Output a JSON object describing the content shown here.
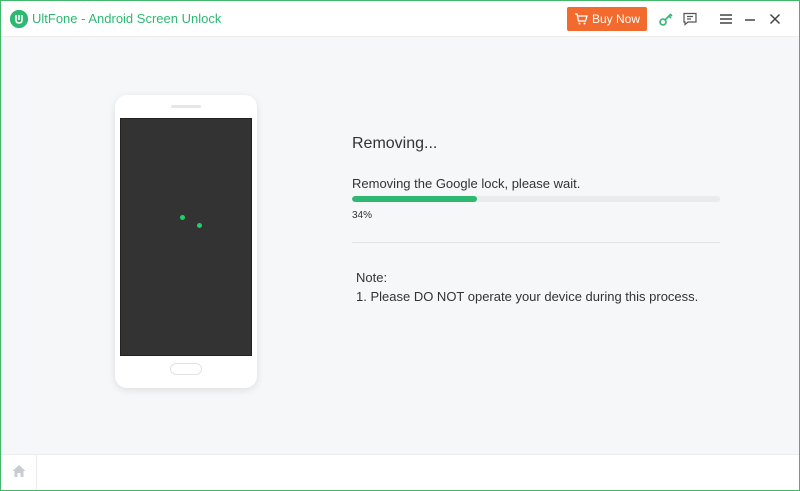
{
  "window": {
    "title": "UltFone - Android Screen Unlock",
    "accent_color": "#2eb872",
    "logo_icon": "ultfone-logo-icon"
  },
  "toolbar": {
    "buy_now_label": "Buy Now",
    "buy_now_icon": "cart-icon",
    "buy_now_color": "#f26a2e",
    "icons": [
      "key-icon",
      "feedback-icon",
      "menu-icon",
      "minimize-icon",
      "close-icon"
    ]
  },
  "status": {
    "title": "Removing...",
    "message": "Removing the Google lock, please wait.",
    "progress_percent": 34,
    "progress_text": "34%"
  },
  "note": {
    "title": "Note:",
    "items": [
      "1. Please DO NOT operate your device during this process."
    ]
  },
  "footer": {
    "home_icon": "home-icon"
  }
}
